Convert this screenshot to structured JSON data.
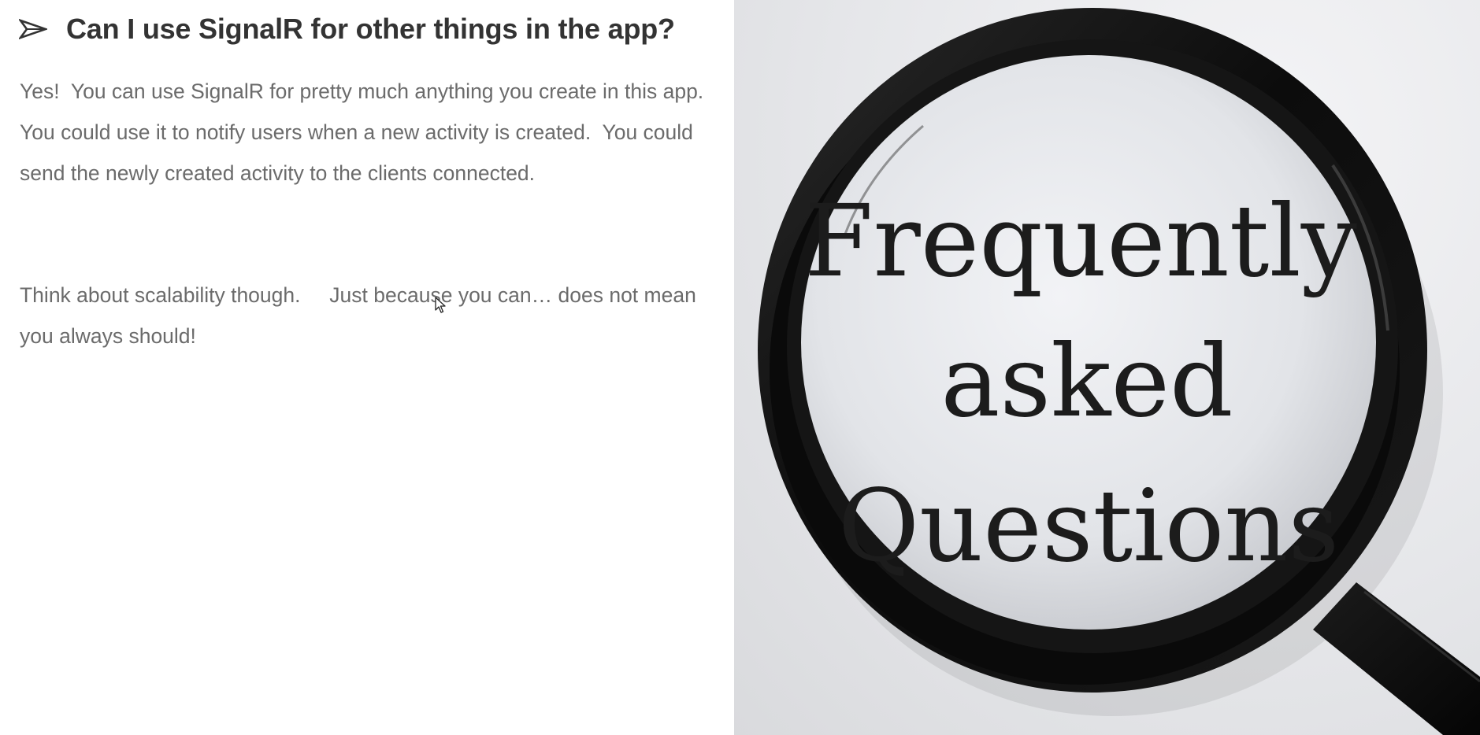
{
  "slide": {
    "heading": "Can I use SignalR for other things in the app?",
    "paragraph_1": "Yes!  You can use SignalR for pretty much anything you create in this app.   You could use it to notify users when a new activity is created.  You could send the newly created activity to the clients connected.",
    "paragraph_2": "Think about scalability though.     Just because you can… does not mean you always should!",
    "bullet_icon": "arrowhead-bullet-icon"
  },
  "image": {
    "description_icon": "magnifying-glass-icon",
    "lens_line_1": "Frequently",
    "lens_line_2": "asked",
    "lens_line_3": "Questions"
  },
  "colors": {
    "heading": "#333333",
    "body_text": "#6b6b6b",
    "background": "#ffffff",
    "lens_frame": "#111111"
  }
}
